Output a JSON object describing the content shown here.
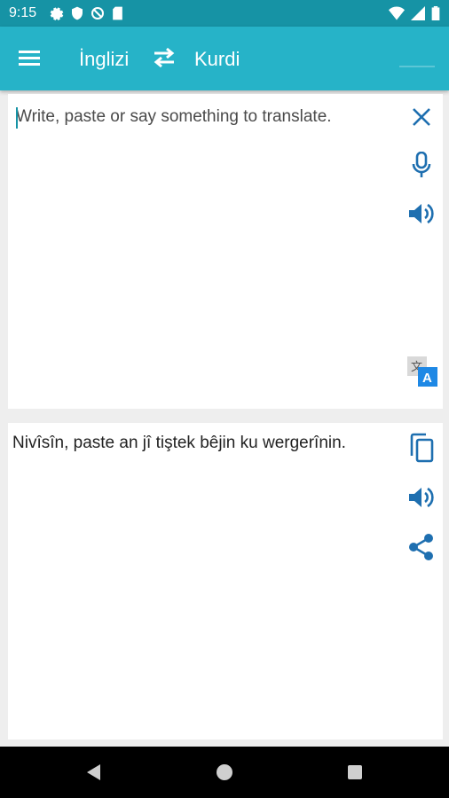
{
  "status_bar": {
    "time": "9:15",
    "left_icons": [
      "gear-icon",
      "shield-icon",
      "blocked-icon",
      "sd-card-icon"
    ],
    "right_icons": [
      "wifi-icon",
      "signal-icon",
      "battery-icon"
    ]
  },
  "app_bar": {
    "source_language": "İnglizi",
    "target_language": "Kurdi",
    "swap_icon": "swap-arrows-icon",
    "menu_icon": "hamburger-menu-icon"
  },
  "input": {
    "placeholder": "Write, paste or say something to translate.",
    "value": ""
  },
  "output": {
    "text": "Nivîsîn, paste an jî tiştek bêjin ku wergerînin."
  },
  "colors": {
    "status_bar": "#1693a5",
    "app_bar": "#26b3c8",
    "icon_accent": "#1e6fb0",
    "background": "#eeeeee"
  }
}
